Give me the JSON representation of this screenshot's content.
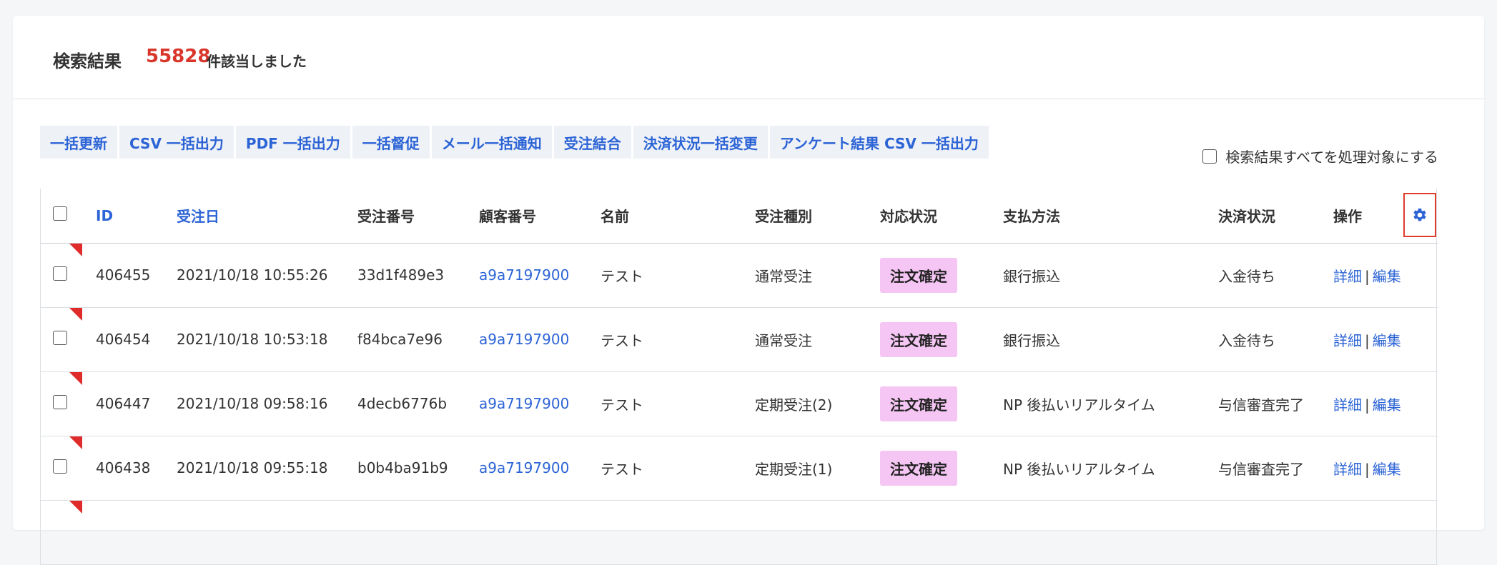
{
  "header": {
    "title": "検索結果",
    "count": "55828",
    "count_suffix": "件該当しました"
  },
  "bulk_actions": [
    "一括更新",
    "CSV 一括出力",
    "PDF 一括出力",
    "一括督促",
    "メール一括通知",
    "受注結合",
    "決済状況一括変更",
    "アンケート結果 CSV 一括出力"
  ],
  "select_all_label": "検索結果すべてを処理対象にする",
  "table": {
    "columns": {
      "id": "ID",
      "order_date": "受注日",
      "order_no": "受注番号",
      "customer_no": "顧客番号",
      "name": "名前",
      "order_type": "受注種別",
      "status": "対応状況",
      "payment_method": "支払方法",
      "payment_status": "決済状況",
      "actions": "操作"
    },
    "actions": {
      "detail": "詳細",
      "edit": "編集",
      "separator": "|"
    },
    "rows": [
      {
        "id": "406455",
        "order_date": "2021/10/18 10:55:26",
        "order_no": "33d1f489e3",
        "customer_no": "a9a7197900",
        "name": "テスト",
        "order_type": "通常受注",
        "status": "注文確定",
        "payment_method": "銀行振込",
        "payment_status": "入金待ち"
      },
      {
        "id": "406454",
        "order_date": "2021/10/18 10:53:18",
        "order_no": "f84bca7e96",
        "customer_no": "a9a7197900",
        "name": "テスト",
        "order_type": "通常受注",
        "status": "注文確定",
        "payment_method": "銀行振込",
        "payment_status": "入金待ち"
      },
      {
        "id": "406447",
        "order_date": "2021/10/18 09:58:16",
        "order_no": "4decb6776b",
        "customer_no": "a9a7197900",
        "name": "テスト",
        "order_type": "定期受注(2)",
        "status": "注文確定",
        "payment_method": "NP 後払いリアルタイム",
        "payment_status": "与信審査完了"
      },
      {
        "id": "406438",
        "order_date": "2021/10/18 09:55:18",
        "order_no": "b0b4ba91b9",
        "customer_no": "a9a7197900",
        "name": "テスト",
        "order_type": "定期受注(1)",
        "status": "注文確定",
        "payment_method": "NP 後払いリアルタイム",
        "payment_status": "与信審査完了"
      }
    ]
  },
  "colors": {
    "accent": "#2c64d6",
    "count": "#d9362b",
    "badge_bg": "#f5c5f3",
    "highlight_border": "#e03b2b"
  },
  "icons": {
    "settings": "gear-icon"
  }
}
